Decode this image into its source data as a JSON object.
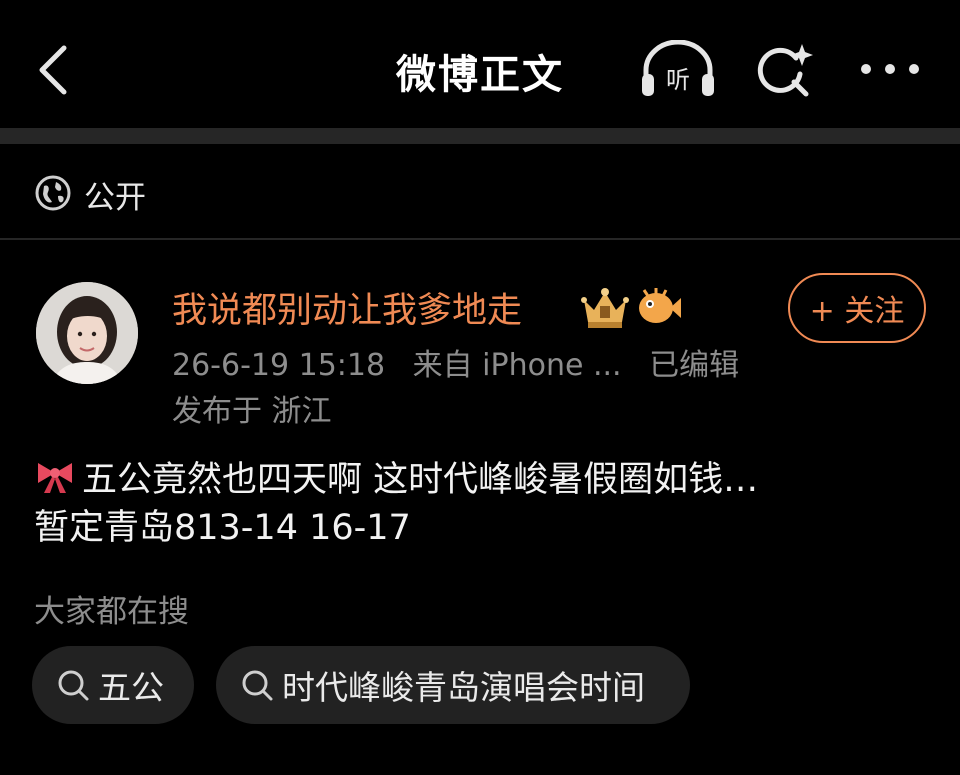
{
  "header": {
    "title": "微博正文",
    "listen_label": "听"
  },
  "visibility": {
    "label": "公开"
  },
  "post": {
    "author": {
      "name": "我说都别动让我爹地走"
    },
    "follow_label": "+ 关注",
    "timestamp": "26-6-19 15:18",
    "source": "来自 iPhone ...",
    "edited": "已编辑",
    "location": "发布于 浙江",
    "content_lines": [
      "五公竟然也四天啊 这时代峰峻暑假圈如钱…",
      "暂定青岛813-14 16-17"
    ]
  },
  "hot_search": {
    "label": "大家都在搜",
    "chips": [
      "五公",
      "时代峰峻青岛演唱会时间"
    ]
  },
  "icons": {
    "back": "chevron-left-icon",
    "listen": "headphones-icon",
    "search": "search-sparkle-icon",
    "more": "more-dots-icon",
    "visibility": "globe-icon",
    "bow": "bow-emoji-icon"
  },
  "colors": {
    "accent": "#f08a54",
    "background": "#000000",
    "secondary_text": "#8d8d8d",
    "chip_bg": "#222222"
  }
}
